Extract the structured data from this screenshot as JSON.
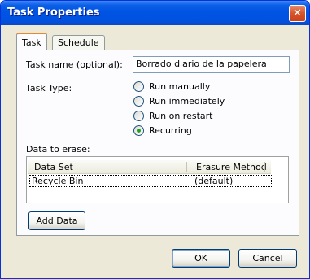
{
  "window": {
    "title": "Task Properties"
  },
  "tabs": [
    {
      "label": "Task",
      "active": true
    },
    {
      "label": "Schedule",
      "active": false
    }
  ],
  "task_name": {
    "label": "Task name (optional):",
    "value": "Borrado diario de la papelera"
  },
  "task_type": {
    "label": "Task Type:",
    "options": [
      {
        "label": "Run manually",
        "checked": false
      },
      {
        "label": "Run immediately",
        "checked": false
      },
      {
        "label": "Run on restart",
        "checked": false
      },
      {
        "label": "Recurring",
        "checked": true
      }
    ]
  },
  "data_to_erase": {
    "label": "Data to erase:",
    "columns": [
      "Data Set",
      "Erasure Method"
    ],
    "rows": [
      [
        "Recycle Bin",
        "(default)"
      ]
    ],
    "add_button": "Add Data"
  },
  "buttons": {
    "ok": "OK",
    "cancel": "Cancel"
  },
  "colors": {
    "titlebar": "#0054e3",
    "face": "#ece9d8",
    "close": "#d8542a"
  }
}
